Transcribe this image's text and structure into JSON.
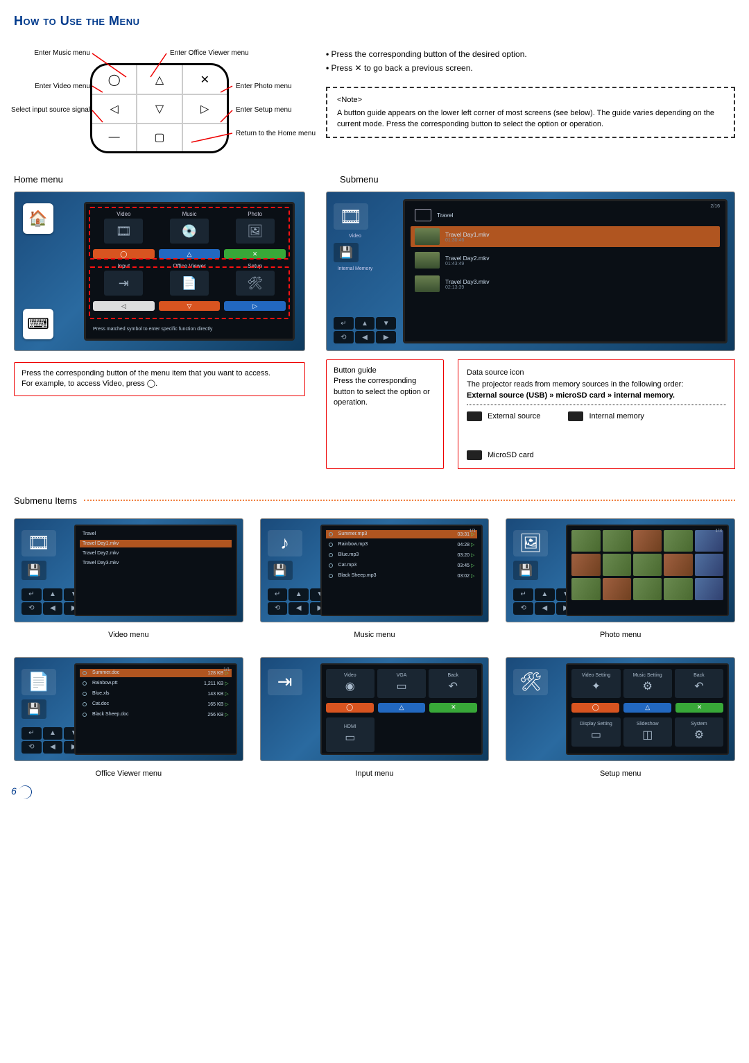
{
  "page_title": "How to Use the Menu",
  "page_number": "6",
  "remote_labels": {
    "music": "Enter Music menu",
    "office": "Enter Office Viewer menu",
    "video": "Enter Video menu",
    "photo": "Enter Photo menu",
    "input": "Select input source signal",
    "setup": "Enter Setup menu",
    "home": "Return to the Home menu"
  },
  "bullets": [
    "Press the corresponding button of the desired option.",
    "Press ✕ to go back a previous screen."
  ],
  "note": {
    "title": "<Note>",
    "body": "A button guide appears on the lower left corner of most screens (see below). The guide varies depending on the current mode. Press the corresponding button to select the option or operation."
  },
  "section_home": "Home menu",
  "section_submenu": "Submenu",
  "home_tiles": {
    "row1": [
      {
        "label": "Video",
        "icon": "video-icon"
      },
      {
        "label": "Music",
        "icon": "music-icon"
      },
      {
        "label": "Photo",
        "icon": "photo-icon"
      }
    ],
    "row2": [
      {
        "label": "Input",
        "icon": "input-icon"
      },
      {
        "label": "Office Viewer",
        "icon": "doc-icon"
      },
      {
        "label": "Setup",
        "icon": "setup-icon"
      }
    ],
    "hint": "Press matched symbol to enter specific function directly"
  },
  "annotation_home": "Press the corresponding button of the menu item that you want to access.\nFor example, to access Video, press ◯.",
  "submenu": {
    "category": "Video",
    "source": "Internal Memory",
    "page": "2/16",
    "folder": "Travel",
    "items": [
      {
        "title": "Travel Day1.mkv",
        "dur": "01:30:46",
        "selected": true
      },
      {
        "title": "Travel Day2.mkv",
        "dur": "01:43:49"
      },
      {
        "title": "Travel Day3.mkv",
        "dur": "02:13:39"
      }
    ]
  },
  "annotation_guide": "Button guide\nPress the corresponding button to select the option or operation.",
  "datasource": {
    "title": "Data source icon",
    "body": "The projector reads from memory sources in the following order:",
    "order_bold": "External source (USB) » microSD card » internal memory.",
    "icons": [
      {
        "label": "External source"
      },
      {
        "label": "Internal memory"
      },
      {
        "label": "MicroSD card"
      }
    ]
  },
  "submenu_items_title": "Submenu Items",
  "mini": {
    "video_cap": "Video menu",
    "music_cap": "Music menu",
    "photo_cap": "Photo menu",
    "office_cap": "Office Viewer menu",
    "input_cap": "Input menu",
    "setup_cap": "Setup menu",
    "video": {
      "folder": "Travel",
      "rows": [
        {
          "t": "Travel Day1.mkv",
          "d": ""
        },
        {
          "t": "Travel Day2.mkv",
          "d": ""
        },
        {
          "t": "Travel Day3.mkv",
          "d": ""
        }
      ]
    },
    "music": {
      "page": "1/1",
      "rows": [
        {
          "t": "Summer.mp3",
          "d": "03:31",
          "sel": true
        },
        {
          "t": "Rainbow.mp3",
          "d": "04:28"
        },
        {
          "t": "Blue.mp3",
          "d": "03:20"
        },
        {
          "t": "Cat.mp3",
          "d": "03:45"
        },
        {
          "t": "Black Sheep.mp3",
          "d": "03:02"
        }
      ]
    },
    "photo": {
      "page": "1/3"
    },
    "office": {
      "page": "1/1",
      "rows": [
        {
          "t": "Summer.doc",
          "d": "128 KB",
          "sel": true
        },
        {
          "t": "Rainbow.ptt",
          "d": "1,211 KB"
        },
        {
          "t": "Blue.xls",
          "d": "143 KB"
        },
        {
          "t": "Cat.doc",
          "d": "165 KB"
        },
        {
          "t": "Black Sheep.doc",
          "d": "256 KB"
        }
      ]
    },
    "input": {
      "tiles": [
        {
          "l": "Video",
          "s": "◉"
        },
        {
          "l": "VGA",
          "s": "▭"
        },
        {
          "l": "Back",
          "s": "↶"
        },
        {
          "l": "",
          "s": "◯"
        },
        {
          "l": "",
          "s": "△"
        },
        {
          "l": "",
          "s": "✕"
        },
        {
          "l": "HDMI",
          "s": "▭"
        }
      ]
    },
    "setup": {
      "tiles": [
        {
          "l": "Video Setting",
          "s": "✦"
        },
        {
          "l": "Music Setting",
          "s": "⚙"
        },
        {
          "l": "Back",
          "s": "↶"
        },
        {
          "l": "",
          "s": "◯"
        },
        {
          "l": "",
          "s": "△"
        },
        {
          "l": "",
          "s": "✕"
        },
        {
          "l": "Display Setting",
          "s": "▭"
        },
        {
          "l": "Slideshow",
          "s": "◫"
        },
        {
          "l": "System",
          "s": "⚙"
        }
      ]
    }
  }
}
